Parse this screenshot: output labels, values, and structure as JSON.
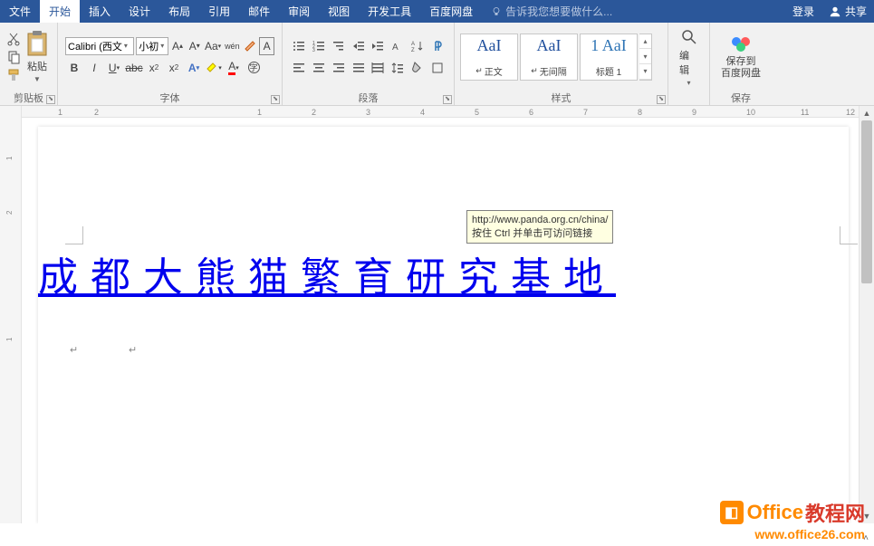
{
  "menu": {
    "tabs": [
      "文件",
      "开始",
      "插入",
      "设计",
      "布局",
      "引用",
      "邮件",
      "审阅",
      "视图",
      "开发工具",
      "百度网盘"
    ],
    "active_index": 1,
    "tell_me": "告诉我您想要做什么...",
    "login": "登录",
    "share": "共享"
  },
  "ribbon": {
    "clipboard": {
      "paste": "粘贴",
      "label": "剪贴板"
    },
    "font": {
      "name": "Calibri (西文",
      "size": "小初",
      "label": "字体"
    },
    "paragraph": {
      "label": "段落"
    },
    "styles": {
      "items": [
        {
          "preview": "AaI",
          "name": "正文"
        },
        {
          "preview": "AaI",
          "name": "无间隔"
        },
        {
          "preview": "1 AaI",
          "name": "标题 1"
        }
      ],
      "label": "样式"
    },
    "editing": {
      "label": "编辑"
    },
    "baidu": {
      "btn": "保存到\n百度网盘",
      "label": "保存"
    }
  },
  "ruler": {
    "h": [
      "",
      "1",
      "2",
      "",
      "",
      "1",
      "2",
      "3",
      "4",
      "5",
      "6",
      "7",
      "8",
      "9",
      "10",
      "11",
      "12"
    ],
    "v": [
      "",
      "1",
      "",
      "2",
      "",
      "1"
    ]
  },
  "document": {
    "heading": "成都大熊猫繁育研究基地",
    "tooltip_url": "http://www.panda.org.cn/china/",
    "tooltip_hint": "按住 Ctrl 并单击可访问链接"
  },
  "watermark": {
    "line1a": "Office",
    "line1b": "教程网",
    "line2": "www.office26.com"
  }
}
